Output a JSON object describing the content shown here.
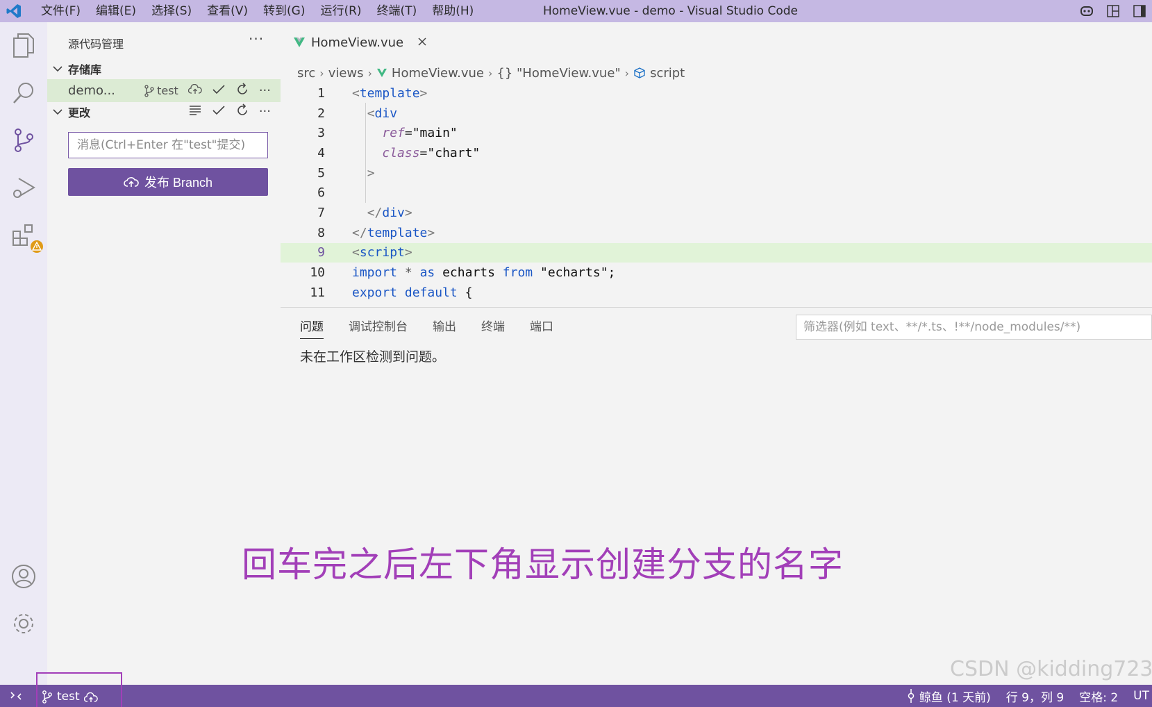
{
  "titlebar": {
    "menus": [
      "文件(F)",
      "编辑(E)",
      "选择(S)",
      "查看(V)",
      "转到(G)",
      "运行(R)",
      "终端(T)",
      "帮助(H)"
    ],
    "window_title": "HomeView.vue - demo - Visual Studio Code"
  },
  "sidebar": {
    "title": "源代码管理",
    "more": "···",
    "repos_section": "存储库",
    "repo_name": "demo...",
    "repo_branch": "test",
    "changes_section": "更改",
    "commit_placeholder": "消息(Ctrl+Enter 在\"test\"提交)",
    "publish_label": "发布 Branch"
  },
  "editor": {
    "tab_label": "HomeView.vue",
    "breadcrumb": [
      "src",
      "views",
      "HomeView.vue",
      "{} \"HomeView.vue\"",
      "script"
    ],
    "lines": [
      {
        "n": "1",
        "html": "<span style='color:#7a7a7a'>&lt;</span><span style='color:#1a56c5'>template</span><span style='color:#7a7a7a'>&gt;</span>"
      },
      {
        "n": "2",
        "html": "  <span style='color:#7a7a7a'>&lt;</span><span style='color:#1a56c5'>div</span>"
      },
      {
        "n": "3",
        "html": "    <span style='color:#8a5a9a;font-style:italic'>ref</span><span style='color:#444'>=</span><span style='color:#111'>\"main\"</span>"
      },
      {
        "n": "4",
        "html": "    <span style='color:#8a5a9a;font-style:italic'>class</span><span style='color:#444'>=</span><span style='color:#111'>\"chart\"</span>"
      },
      {
        "n": "5",
        "html": "  <span style='color:#7a7a7a'>&gt;</span>"
      },
      {
        "n": "6",
        "html": ""
      },
      {
        "n": "7",
        "html": "  <span style='color:#7a7a7a'>&lt;/</span><span style='color:#1a56c5'>div</span><span style='color:#7a7a7a'>&gt;</span>"
      },
      {
        "n": "8",
        "html": "<span style='color:#7a7a7a'>&lt;/</span><span style='color:#1a56c5'>template</span><span style='color:#7a7a7a'>&gt;</span>"
      },
      {
        "n": "9",
        "html": "<span style='color:#7a7a7a'>&lt;</span><span style='color:#1a56c5'>script</span><span style='color:#7a7a7a'>&gt;</span>"
      },
      {
        "n": "10",
        "html": "<span style='color:#1a56c5'>import</span> <span style='color:#555'>*</span> <span style='color:#1a56c5'>as</span> <span style='color:#111'>echarts</span> <span style='color:#1a56c5'>from</span> <span style='color:#111'>\"echarts\"</span><span style='color:#111'>;</span>"
      },
      {
        "n": "11",
        "html": "<span style='color:#1a56c5'>export</span> <span style='color:#1a56c5'>default</span> <span style='color:#111'>{</span>"
      }
    ],
    "active_line": "9"
  },
  "panel": {
    "tabs": [
      "问题",
      "调试控制台",
      "输出",
      "终端",
      "端口"
    ],
    "filter_placeholder": "筛选器(例如 text、**/*.ts、!**/node_modules/**)",
    "message": "未在工作区检测到问题。",
    "annotation": "回车完之后左下角显示创建分支的名字"
  },
  "statusbar": {
    "branch": "test",
    "blame": "鲸鱼 (1 天前)",
    "position": "行 9，列 9",
    "spaces": "空格: 2",
    "encoding": "UT"
  },
  "watermark": "CSDN @kidding723",
  "colors": {
    "titlebar": "#c5b8e3",
    "accent": "#6f52a0",
    "annotation": "#a23fb8",
    "active_line": "#e1f3d8"
  }
}
